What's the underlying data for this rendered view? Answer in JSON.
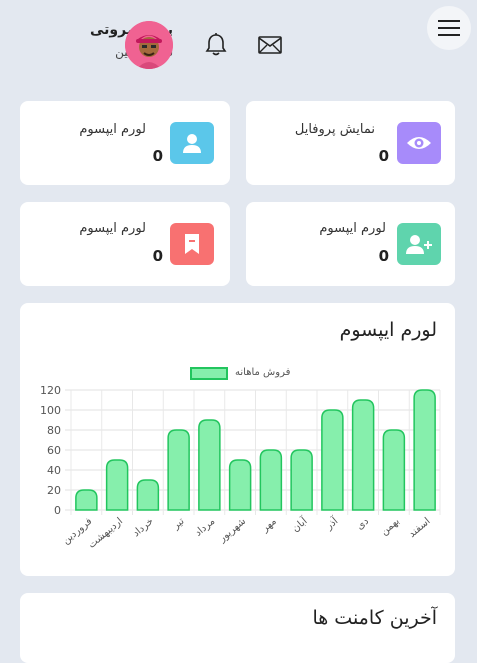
{
  "header": {
    "user_name": "پوریا مروتی",
    "user_role": "سوپر ادمین",
    "icons": [
      "menu-icon",
      "bell-icon",
      "mail-icon"
    ]
  },
  "stats": [
    {
      "label": "نمایش پروفایل",
      "value": "0",
      "icon": "eye-icon",
      "color": "#a78bfa"
    },
    {
      "label": "لورم ایپسوم",
      "value": "0",
      "icon": "user-icon",
      "color": "#5bc7ea"
    },
    {
      "label": "لورم ایپسوم",
      "value": "0",
      "icon": "user-plus-icon",
      "color": "#5fd4ad"
    },
    {
      "label": "لورم ایپسوم",
      "value": "0",
      "icon": "bookmark-icon",
      "color": "#f87171"
    }
  ],
  "chart_section": {
    "title": "لورم ایپسوم"
  },
  "chart_data": {
    "type": "bar",
    "legend": "فروش ماهانه",
    "legend_position": "top",
    "categories": [
      "فروردین",
      "اردیبهشت",
      "خرداد",
      "تیر",
      "مرداد",
      "شهریور",
      "مهر",
      "آبان",
      "آذر",
      "دی",
      "بهمن",
      "اسفند"
    ],
    "series": [
      {
        "name": "فروش ماهانه",
        "values": [
          20,
          50,
          30,
          80,
          90,
          50,
          60,
          60,
          100,
          110,
          80,
          120
        ]
      }
    ],
    "ylim": [
      0,
      120
    ],
    "yticks": [
      0,
      20,
      40,
      60,
      80,
      100,
      120
    ],
    "grid": true,
    "fill_color": "#86efac",
    "border_color": "#22c55e"
  },
  "comments": {
    "title": "آخرین کامنت ها"
  }
}
